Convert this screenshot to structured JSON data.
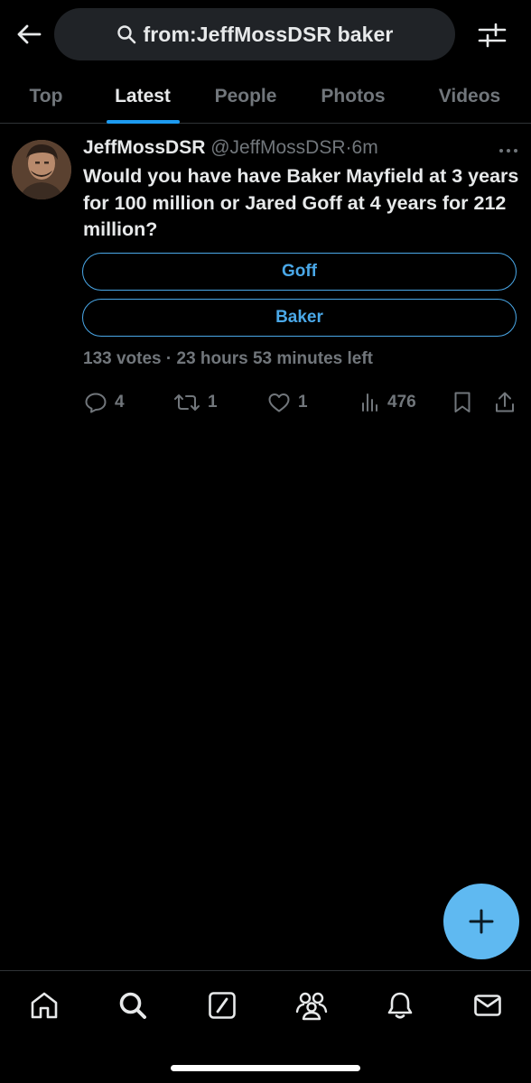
{
  "search": {
    "query": "from:JeffMossDSR baker"
  },
  "tabs": [
    {
      "label": "Top"
    },
    {
      "label": "Latest"
    },
    {
      "label": "People"
    },
    {
      "label": "Photos"
    },
    {
      "label": "Videos"
    }
  ],
  "active_tab": "Latest",
  "tweet": {
    "display_name": "JeffMossDSR",
    "handle": "@JeffMossDSR",
    "separator": "·",
    "time": "6m",
    "text": "Would you have have Baker Mayfield at 3 years for 100 million or Jared Goff at 4 years for 212 million?",
    "poll": {
      "options": [
        {
          "label": "Goff"
        },
        {
          "label": "Baker"
        }
      ],
      "meta": "133 votes · 23 hours 53 minutes left"
    },
    "stats": {
      "replies": "4",
      "retweets": "1",
      "likes": "1",
      "views": "476"
    }
  },
  "icons": {
    "back": "arrow-left-icon",
    "search": "search-icon",
    "filter": "sliders-icon",
    "more": "more-horizontal-icon",
    "reply": "reply-icon",
    "retweet": "retweet-icon",
    "like": "heart-icon",
    "views": "views-icon",
    "bookmark": "bookmark-icon",
    "share": "share-icon",
    "compose": "plus-icon",
    "nav": [
      "home-icon",
      "search-icon",
      "grok-icon",
      "communities-icon",
      "bell-icon",
      "mail-icon"
    ]
  },
  "colors": {
    "accent": "#1d9bf0",
    "poll": "#4aa8e8",
    "fab": "#5fb9f1",
    "muted": "#71767b",
    "text": "#e7e9ea"
  }
}
